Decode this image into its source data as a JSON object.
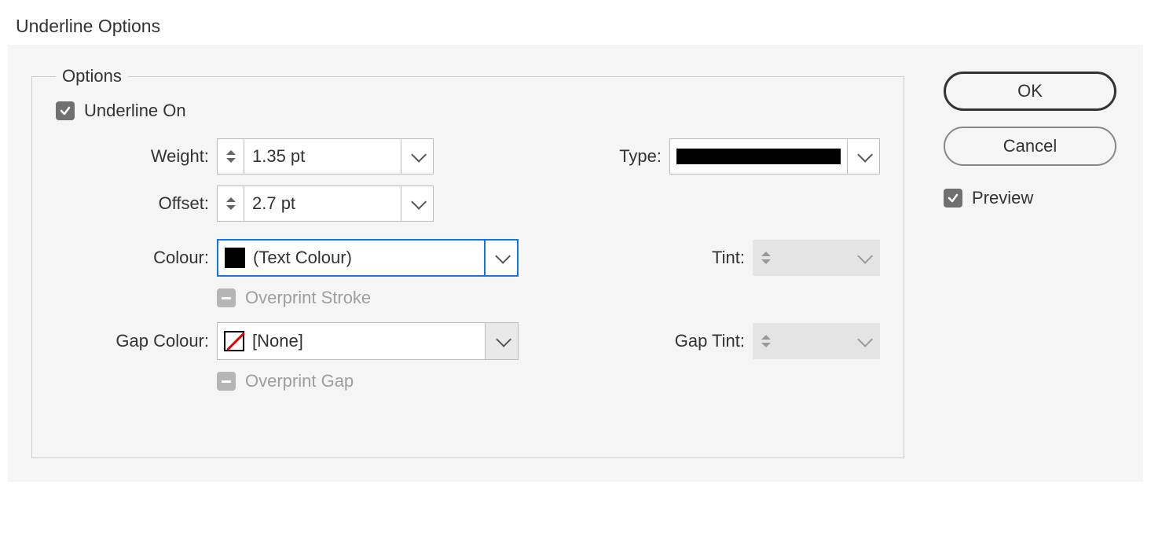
{
  "dialog": {
    "title": "Underline Options",
    "frame_legend": "Options"
  },
  "underline_on": {
    "label": "Underline On",
    "checked": true
  },
  "labels": {
    "weight": "Weight:",
    "offset": "Offset:",
    "colour": "Colour:",
    "gap_colour": "Gap Colour:",
    "type": "Type:",
    "tint": "Tint:",
    "gap_tint": "Gap Tint:",
    "overprint_stroke": "Overprint Stroke",
    "overprint_gap": "Overprint Gap"
  },
  "values": {
    "weight": "1.35 pt",
    "offset": "2.7 pt",
    "colour_name": "(Text Colour)",
    "gap_colour_name": "[None]",
    "tint": "",
    "gap_tint": ""
  },
  "overprint_stroke": {
    "enabled": false
  },
  "overprint_gap": {
    "enabled": false
  },
  "buttons": {
    "ok": "OK",
    "cancel": "Cancel",
    "preview": "Preview"
  },
  "preview_checked": true
}
